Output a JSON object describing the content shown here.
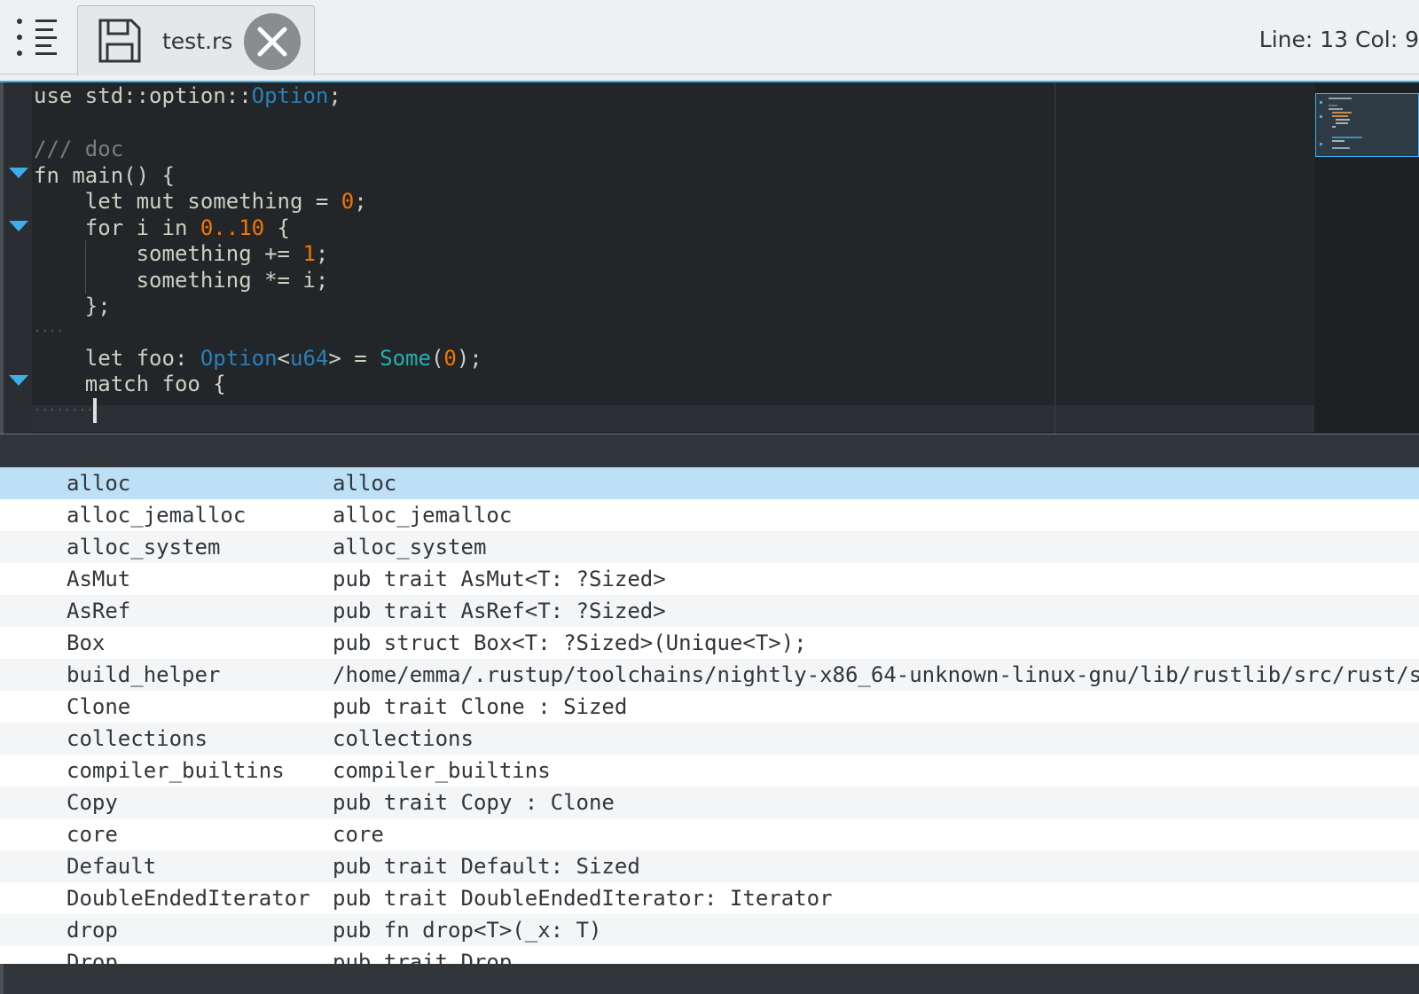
{
  "tab": {
    "title": "test.rs"
  },
  "status": {
    "position": "Line: 13 Col: 9"
  },
  "icons": {
    "menu": "hamburger-list-icon",
    "save": "save-icon",
    "close": "close-icon",
    "fold": "fold-triangle-icon"
  },
  "colors": {
    "accent": "#3daee9",
    "editor_bg": "#232629",
    "keyword_type": "#2980b9",
    "number": "#f67400",
    "selected_row": "#bde0f6"
  },
  "code": [
    {
      "t1": "use std::option::",
      "t2": "Option",
      "t3": ";"
    },
    {},
    {
      "comment": "/// doc"
    },
    {
      "text": "fn main() {"
    },
    {
      "a": "    let mut something = ",
      "b": "0",
      "c": ";"
    },
    {
      "a": "    for i in ",
      "b": "0..10",
      "c": " {"
    },
    {
      "a": "        something += ",
      "b": "1",
      "c": ";"
    },
    {
      "text": "        something *= i;"
    },
    {
      "text": "    };"
    },
    {
      "ws": "····"
    },
    {
      "a": "    let foo: ",
      "opt": "Option",
      "lt": "<",
      "u": "u64",
      "gt": "> = ",
      "some": "Some",
      "p1": "(",
      "z": "0",
      "p2": ");"
    },
    {
      "text": "    match foo {"
    },
    {
      "ws": "········"
    }
  ],
  "completion": {
    "items": [
      {
        "name": "alloc",
        "detail": "alloc"
      },
      {
        "name": "alloc_jemalloc",
        "detail": "alloc_jemalloc"
      },
      {
        "name": "alloc_system",
        "detail": "alloc_system"
      },
      {
        "name": "AsMut",
        "detail": "pub trait AsMut<T: ?Sized>"
      },
      {
        "name": "AsRef",
        "detail": "pub trait AsRef<T: ?Sized>"
      },
      {
        "name": "Box",
        "detail": "pub struct Box<T: ?Sized>(Unique<T>);"
      },
      {
        "name": "build_helper",
        "detail": "/home/emma/.rustup/toolchains/nightly-x86_64-unknown-linux-gnu/lib/rustlib/src/rust/s"
      },
      {
        "name": "Clone",
        "detail": "pub trait Clone : Sized"
      },
      {
        "name": "collections",
        "detail": "collections"
      },
      {
        "name": "compiler_builtins",
        "detail": "compiler_builtins"
      },
      {
        "name": "Copy",
        "detail": "pub trait Copy : Clone"
      },
      {
        "name": "core",
        "detail": "core"
      },
      {
        "name": "Default",
        "detail": "pub trait Default: Sized"
      },
      {
        "name": "DoubleEndedIterator",
        "detail": "pub trait DoubleEndedIterator: Iterator"
      },
      {
        "name": "drop",
        "detail": "pub fn drop<T>(_x: T)"
      },
      {
        "name": "Drop",
        "detail": "pub trait Drop"
      }
    ]
  }
}
